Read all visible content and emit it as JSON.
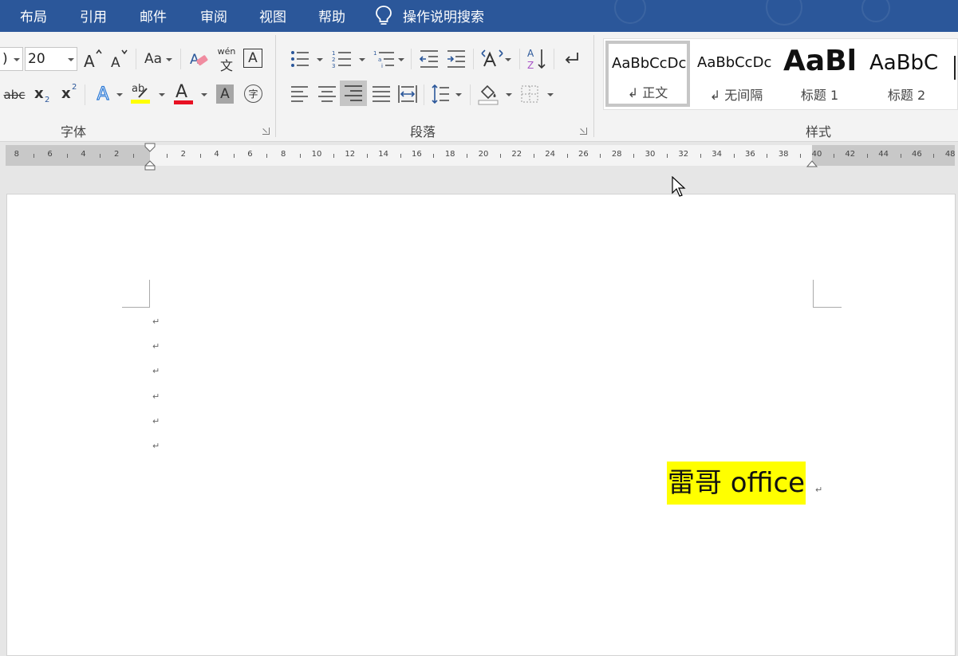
{
  "menu": {
    "items": [
      "布局",
      "引用",
      "邮件",
      "审阅",
      "视图",
      "帮助"
    ],
    "tell_me": "操作说明搜索"
  },
  "font_group": {
    "label": "字体",
    "font_name_partial": ")",
    "font_size": "20",
    "change_case": "Aa",
    "phonetic_top": "wén",
    "phonetic_bottom": "文",
    "char_border": "A",
    "strikethrough": "abc",
    "subscript": "x",
    "subscript_mark": "2",
    "superscript": "x",
    "superscript_mark": "2",
    "text_effects": "A",
    "highlight_text": "ab",
    "font_color": "A",
    "shading": "A",
    "enclose": "字",
    "highlight_color": "#ffff00",
    "font_color_value": "#e81123"
  },
  "paragraph_group": {
    "label": "段落"
  },
  "styles_group": {
    "label": "样式",
    "items": [
      {
        "sample": "AaBbCcDc",
        "name": "↲ 正文"
      },
      {
        "sample": "AaBbCcDc",
        "name": "↲ 无间隔"
      },
      {
        "sample": "AaBl",
        "name": "标题 1"
      },
      {
        "sample": "AaBbC",
        "name": "标题 2"
      }
    ]
  },
  "ruler": {
    "labels": [
      "8",
      "6",
      "4",
      "2",
      "2",
      "4",
      "6",
      "8",
      "10",
      "12",
      "14",
      "16",
      "18",
      "20",
      "22",
      "24",
      "26",
      "28",
      "30",
      "32",
      "34",
      "36",
      "38",
      "40",
      "42",
      "44",
      "46",
      "48"
    ]
  },
  "document": {
    "text": "雷哥 office",
    "paragraph_mark": "↵"
  },
  "colors": {
    "ribbon_blue": "#2b579a",
    "highlight": "#ffff00"
  }
}
